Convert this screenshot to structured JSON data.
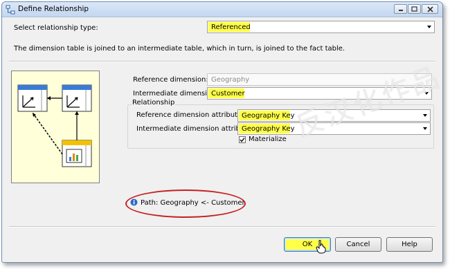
{
  "window": {
    "title": "Define Relationship",
    "controls": {
      "minimize": "minimize",
      "maximize": "maximize",
      "close": "close"
    }
  },
  "relationship_type": {
    "label": "Select relationship type:",
    "value": "Referenced"
  },
  "description": "The dimension table is joined to an intermediate table, which in turn, is joined to the fact table.",
  "form": {
    "reference_dimension_label": "Reference dimension:",
    "reference_dimension_value": "Geography",
    "intermediate_dimension_label": "Intermediate dimension:",
    "intermediate_dimension_value": "Customer",
    "relationship_group_label": "Relationship",
    "reference_attribute_label": "Reference dimension attribute:",
    "reference_attribute_value": "Geography Key",
    "intermediate_attribute_label": "Intermediate dimension attribute:",
    "intermediate_attribute_value": "Geography Key",
    "materialize_label": "Materialize",
    "materialize_checked": true
  },
  "path": {
    "icon": "info-icon",
    "text": "Path: Geography <- Customer"
  },
  "buttons": {
    "ok": "OK",
    "cancel": "Cancel",
    "help": "Help"
  },
  "watermark": "反汉化作品",
  "colors": {
    "highlight": "#ffff4a",
    "annotation": "#c62020",
    "diagram_bg": "#ffffd9"
  }
}
